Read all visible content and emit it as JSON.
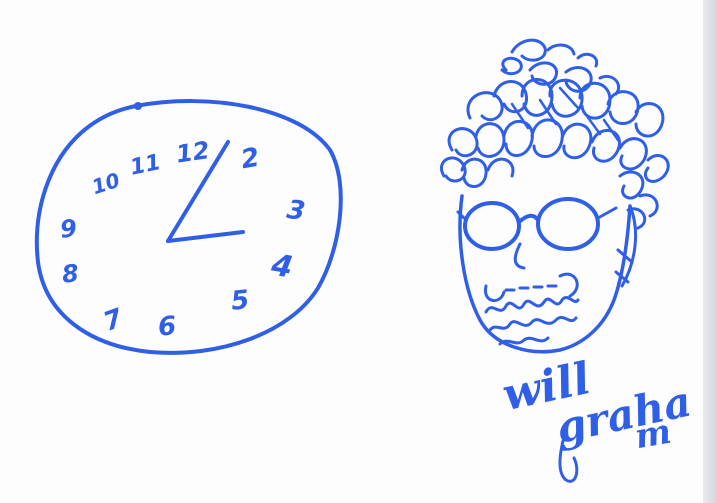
{
  "sketch": {
    "ink_color": "#2f5fe6",
    "paper_color": "#fdfdfe",
    "clock": {
      "numerals": [
        "12",
        "2",
        "3",
        "4",
        "5",
        "6",
        "7",
        "8",
        "9",
        "10",
        "11"
      ],
      "time_shown": "2:17"
    },
    "portrait": {
      "signature_line1": "will",
      "signature_line2": "graha",
      "signature_line3": "m"
    }
  }
}
